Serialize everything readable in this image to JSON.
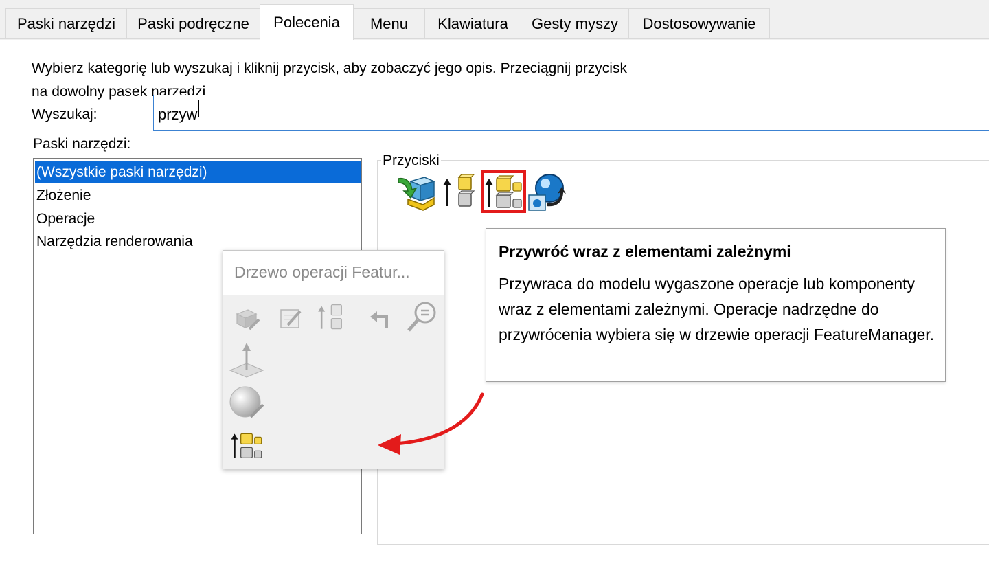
{
  "tabs": [
    {
      "label": "Paski narzędzi",
      "active": false
    },
    {
      "label": "Paski podręczne",
      "active": false
    },
    {
      "label": "Polecenia",
      "active": true
    },
    {
      "label": "Menu",
      "active": false
    },
    {
      "label": "Klawiatura",
      "active": false
    },
    {
      "label": "Gesty myszy",
      "active": false
    },
    {
      "label": "Dostosowywanie",
      "active": false
    }
  ],
  "instructions": {
    "line1": "Wybierz kategorię lub wyszukaj i kliknij przycisk, aby zobaczyć jego opis. Przeciągnij przycisk",
    "line2": "na dowolny pasek narzędzi"
  },
  "search": {
    "label": "Wyszukaj:",
    "value": "przyw"
  },
  "toolbars": {
    "label": "Paski narzędzi:",
    "items": [
      "(Wszystkie paski narzędzi)",
      "Złożenie",
      "Operacje",
      "Narzędzia renderowania"
    ],
    "selected_index": 0
  },
  "buttons_group": {
    "label": "Przyciski",
    "icons": [
      "restore-component-icon",
      "unsuppress-icon",
      "unsuppress-with-dependents-icon",
      "restore-appearance-icon"
    ],
    "highlighted_icon": "unsuppress-with-dependents-icon",
    "highlight_color": "#e31b1b"
  },
  "tooltip": {
    "title": "Przywróć wraz z elementami zależnymi",
    "body": "Przywraca do modelu wygaszone operacje lub komponenty wraz z elementami zależnymi. Operacje nadrzędne do przywrócenia wybiera się w drzewie operacji FeatureManager."
  },
  "context_toolbar": {
    "title": "Drzewo operacji Featur...",
    "icons": [
      "edit-feature-icon",
      "edit-sketch-icon",
      "unsuppress-icon",
      "rollback-icon",
      "zoom-to-selection-icon",
      "normal-to-icon",
      "appearance-icon",
      "unsuppress-with-dependents-icon"
    ]
  },
  "annotation": {
    "arrow_color": "#e31b1b"
  }
}
